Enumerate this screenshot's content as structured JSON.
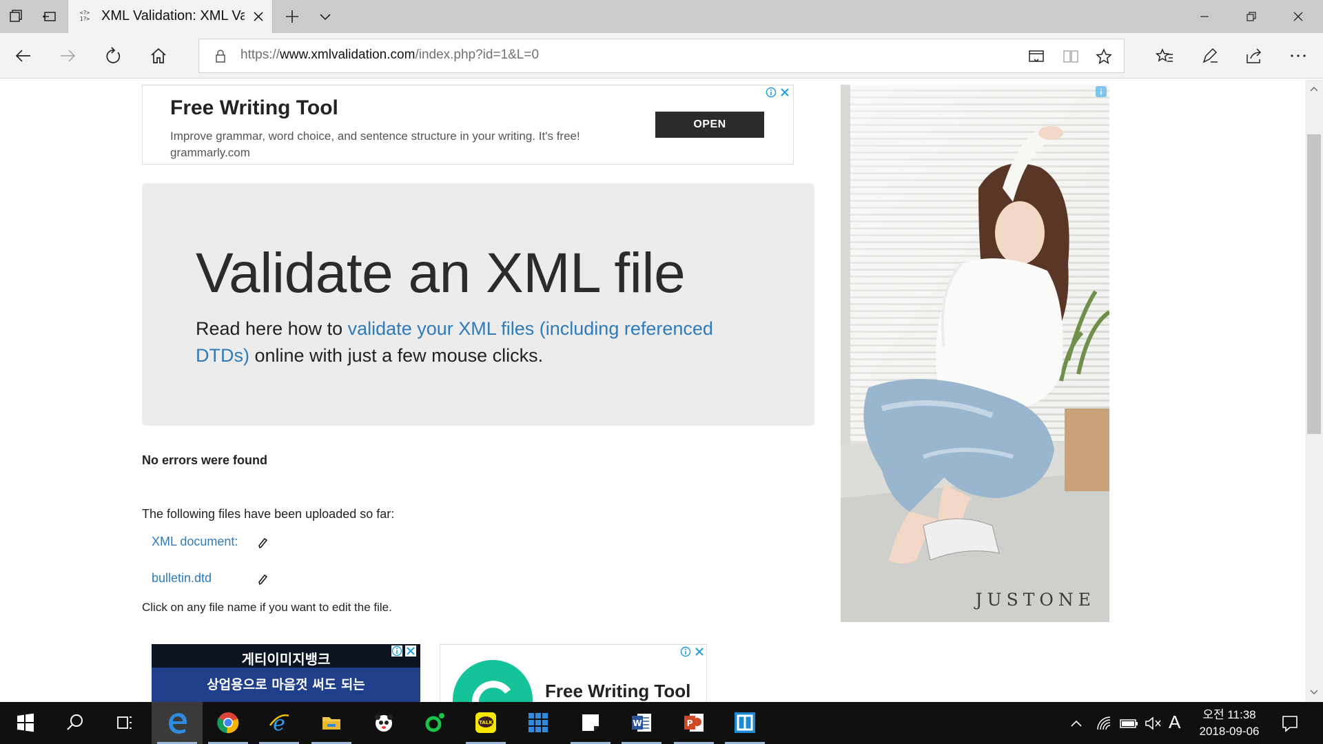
{
  "tab": {
    "title": "XML Validation: XML Va"
  },
  "address": {
    "scheme": "https://",
    "host": "www.xmlvalidation.com",
    "path": "/index.php?id=1&L=0"
  },
  "ad_top": {
    "title": "Free Writing Tool",
    "description": "Improve grammar, word choice, and sentence structure in your writing. It's free!",
    "domain": "grammarly.com",
    "button": "OPEN"
  },
  "hero": {
    "title": "Validate an XML file",
    "lead_before": "Read here how to ",
    "lead_link": "validate your XML files (including referenced DTDs)",
    "lead_after": " online with just a few mouse clicks."
  },
  "result": {
    "status": "No errors were found",
    "uploaded_intro": "The following files have been uploaded so far:",
    "files": [
      "XML document:",
      "bulletin.dtd"
    ],
    "hint": "Click on any file name if you want to edit the file."
  },
  "ad_korean": {
    "line1": "게티이미지뱅크",
    "line2": "상업용으로 마음껏 써도 되는"
  },
  "ad_bottom": {
    "title": "Free Writing Tool"
  },
  "side_ad": {
    "brand": "JUSTONE"
  },
  "taskbar": {
    "apps": [
      "start",
      "search",
      "task-view",
      "edge",
      "chrome",
      "internet-explorer",
      "file-explorer",
      "game-app",
      "green-app",
      "kakaotalk",
      "grid-app",
      "sticky-notes",
      "word",
      "powerpoint",
      "remote-app"
    ],
    "active_app": "edge",
    "keyboard": "A",
    "clock_time": "오전 11:38",
    "clock_date": "2018-09-06"
  },
  "colors": {
    "link": "#2f7ab8",
    "hero_bg": "#ececec",
    "taskbar": "#101010",
    "tabbar": "#cccccc"
  }
}
